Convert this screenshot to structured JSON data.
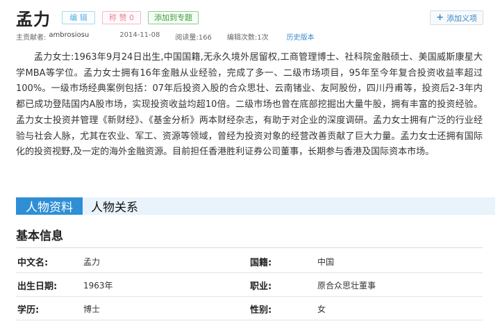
{
  "header": {
    "title": "孟力",
    "edit_label": "编 辑",
    "like_label": "称 赞 0",
    "add_topic_label": "添加到专题",
    "add_meaning_label": "添加义项",
    "add_meaning_icon": "plus-icon"
  },
  "meta": {
    "author_label": "主贡献者:",
    "author": "ambrosiosu",
    "date": "2014-11-08",
    "views_label": "阅读量:",
    "views": "166",
    "edits_label": "编辑次数:",
    "edits": "1次",
    "history_label": "历史版本"
  },
  "intro": "孟力女士:1963年9月24日出生,中国国籍,无永久境外居留权,工商管理博士、社科院金融硕士、美国威斯康星大学MBA等学位。孟力女士拥有16年金融从业经验，完成了多一、二级市场项目，95年至今年复合投资收益率超过100%。一级市场经典案例包括：07年后投资入股的合众思壮、云南锗业、友阿股份，四川丹甫等，投资后2-3年内都已成功登陆国内A股市场，实现投资收益均超10倍。二级市场也曾在底部挖掘出大量牛股，拥有丰富的投资经验。孟力女士投资并管理《新财经》、《基金分析》两本财经杂志，有助于对企业的深度调研。孟力女士拥有广泛的行业经验与社会人脉，尤其在农业、军工、资源等领域，曾经为投资对象的经营改善贡献了巨大力量。孟力女士还拥有国际化的投资视野,及一定的海外金融资源。目前担任香港胜利证券公司董事，长期参与香港及国际资本市场。",
  "tabs": [
    {
      "label": "人物资料",
      "active": true
    },
    {
      "label": "人物关系",
      "active": false
    }
  ],
  "basic_info": {
    "title": "基本信息",
    "rows": [
      [
        {
          "label": "中文名:",
          "value": "孟力"
        },
        {
          "label": "国籍:",
          "value": "中国"
        }
      ],
      [
        {
          "label": "出生日期:",
          "value": "1963年"
        },
        {
          "label": "职业:",
          "value": "原合众思壮董事"
        }
      ],
      [
        {
          "label": "学历:",
          "value": "博士"
        },
        {
          "label": "性别:",
          "value": "女"
        }
      ]
    ]
  },
  "colors": {
    "accent": "#2f8fd5",
    "tab_bar_bg": "#e8f3fb",
    "link": "#3a87c8"
  }
}
